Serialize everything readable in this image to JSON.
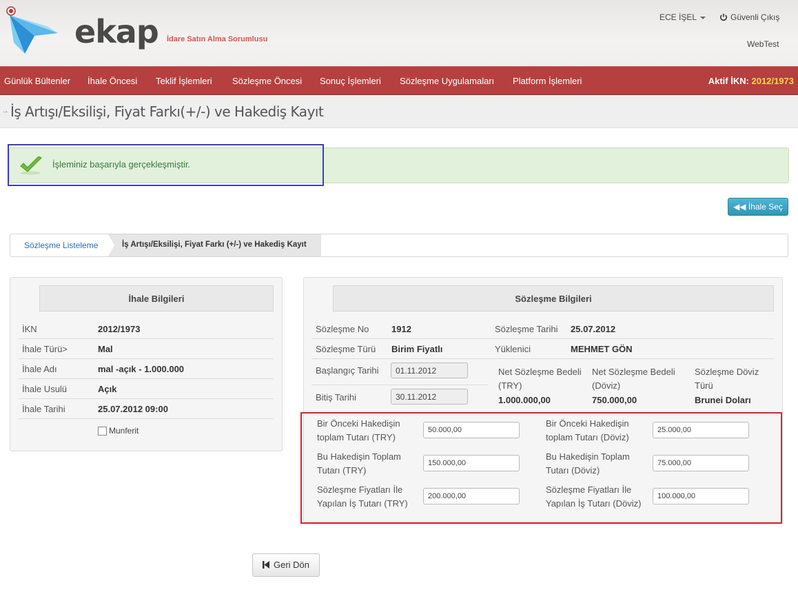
{
  "header": {
    "logo_text": "ekap",
    "logo_subtitle": "İdare Satın Alma Sorumlusu",
    "user_name": "ECE İŞEL",
    "logout_label": "Güvenli Çıkış",
    "environment": "WebTest"
  },
  "nav": {
    "items": [
      {
        "label": "Günlük Bültenler"
      },
      {
        "label": "İhale Öncesi"
      },
      {
        "label": "Teklif İşlemleri"
      },
      {
        "label": "Sözleşme Öncesi"
      },
      {
        "label": "Sonuç İşlemleri"
      },
      {
        "label": "Sözleşme Uygulamaları"
      },
      {
        "label": "Platform İşlemleri"
      }
    ],
    "active_ikn_label": "Aktif İKN:",
    "active_ikn_value": "2012/1973"
  },
  "page": {
    "title": "İş Artışı/Eksilişi, Fiyat Farkı(+/-) ve Hakediş Kayıt"
  },
  "alert": {
    "message": "İşleminiz başarıyla gerçekleşmiştir."
  },
  "actions": {
    "select_tender_label": "İhale Seç",
    "back_label": "Geri Dön"
  },
  "breadcrumb": {
    "items": [
      {
        "label": "Sözleşme Listeleme"
      },
      {
        "label": "İş Artışı/Eksilişi, Fiyat Farkı (+/-) ve Hakediş Kayıt"
      }
    ]
  },
  "tender_info": {
    "heading": "İhale Bilgileri",
    "rows": [
      {
        "label": "İKN",
        "value": "2012/1973"
      },
      {
        "label": "İhale Türü>",
        "value": "Mal"
      },
      {
        "label": "İhale Adı",
        "value": "mal -açık - 1.000.000"
      },
      {
        "label": "İhale Usulü",
        "value": "Açık"
      },
      {
        "label": "İhale Tarihi",
        "value": "25.07.2012 09:00"
      }
    ],
    "checkbox_label": "Munferit",
    "checkbox_checked": false
  },
  "contract_info": {
    "heading": "Sözleşme Bilgileri",
    "contract_no_label": "Sözleşme No",
    "contract_no": "1912",
    "contract_date_label": "Sözleşme Tarihi",
    "contract_date": "25.07.2012",
    "contract_type_label": "Sözleşme Türü",
    "contract_type": "Birim Fiyatlı",
    "contractor_label": "Yüklenici",
    "contractor": "MEHMET GÖN",
    "start_date_label": "Başlangıç Tarihi",
    "start_date": "01.11.2012",
    "end_date_label": "Bitiş Tarihi",
    "end_date": "30.11.2012",
    "net_try_label_1": "Net Sözleşme Bedeli",
    "net_try_label_2": "(TRY)",
    "net_try": "1.000.000,00",
    "net_fx_label_1": "Net Sözleşme Bedeli",
    "net_fx_label_2": "(Döviz)",
    "net_fx": "750.000,00",
    "currency_label_1": "Sözleşme Döviz",
    "currency_label_2": "Türü",
    "currency": "Brunei Doları"
  },
  "progress_payment": {
    "fields": [
      {
        "label_1": "Bir Önceki Hakedişin",
        "label_2": "toplam Tutarı (TRY)",
        "value": "50.000,00"
      },
      {
        "label_1": "Bir Önceki Hakedişin",
        "label_2": "toplam Tutarı (Döviz)",
        "value": "25.000,00"
      },
      {
        "label_1": "Bu Hakedişin Toplam",
        "label_2": "Tutarı (TRY)",
        "value": "150.000,00"
      },
      {
        "label_1": "Bu Hakedişin Toplam",
        "label_2": "Tutarı (Döviz)",
        "value": "75.000,00"
      },
      {
        "label_1": "Sözleşme Fiyatları İle",
        "label_2": "Yapılan İş Tutarı (TRY)",
        "value": "200.000,00"
      },
      {
        "label_1": "Sözleşme Fiyatları İle",
        "label_2": "Yapılan İş Tutarı (Döviz)",
        "value": "100.000,00"
      }
    ]
  },
  "colors": {
    "nav_bg": "#b5403f",
    "ikn_highlight": "#ffd34e",
    "alert_bg": "#e1f1dc",
    "alert_text": "#3c763d",
    "info_button": "#2f96b4",
    "highlight_blue": "#3b3fbf",
    "highlight_red": "#e0202a"
  }
}
